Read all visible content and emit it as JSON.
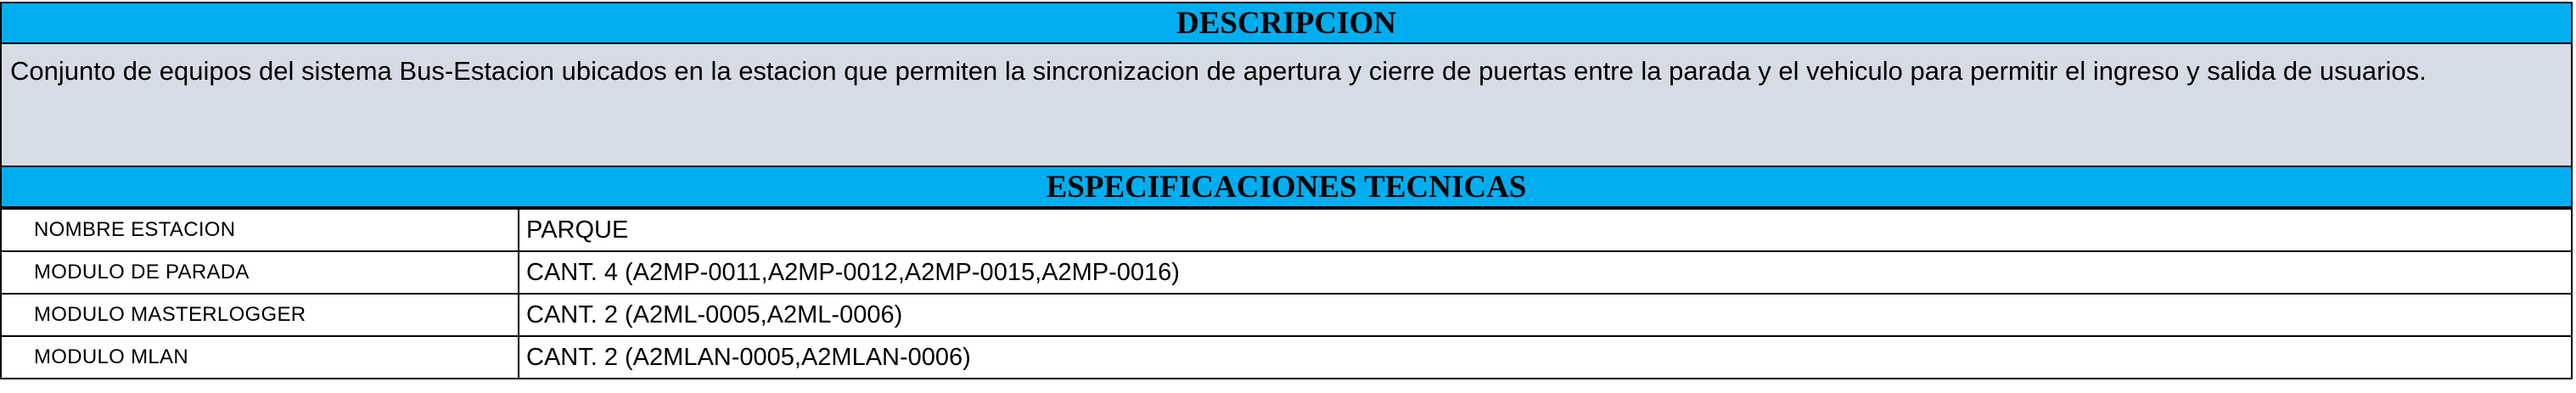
{
  "sections": {
    "description_title": "DESCRIPCION",
    "description_text": "Conjunto de equipos del sistema Bus-Estacion ubicados en la estacion que permiten la sincronizacion de apertura y cierre de puertas entre la parada y el vehiculo para permitir el ingreso y salida de usuarios.",
    "specs_title": "ESPECIFICACIONES TECNICAS"
  },
  "specs": [
    {
      "label": "NOMBRE ESTACION",
      "value": "PARQUE"
    },
    {
      "label": "MODULO DE PARADA",
      "value": "CANT. 4 (A2MP-0011,A2MP-0012,A2MP-0015,A2MP-0016)"
    },
    {
      "label": "MODULO MASTERLOGGER",
      "value": "CANT. 2 (A2ML-0005,A2ML-0006)"
    },
    {
      "label": "MODULO MLAN",
      "value": "CANT. 2 (A2MLAN-0005,A2MLAN-0006)"
    }
  ],
  "colors": {
    "header_band": "#00aeef",
    "description_bg": "#d6dce5",
    "border": "#000000"
  }
}
